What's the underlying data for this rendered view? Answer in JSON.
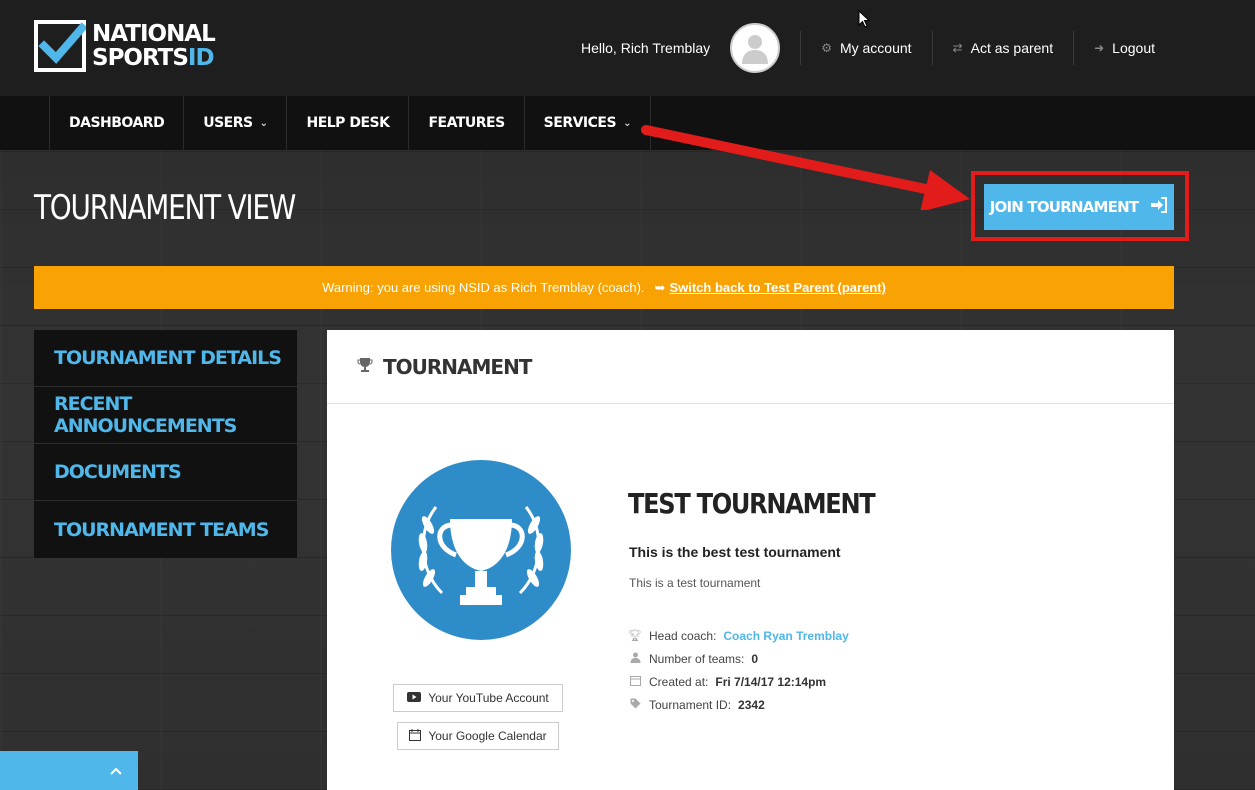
{
  "header": {
    "logo": {
      "line1": "NATIONAL",
      "line2_a": "SPORTS",
      "line2_b": "ID"
    },
    "greeting": "Hello, Rich Tremblay",
    "links": [
      {
        "label": "My account",
        "icon": "gear-icon"
      },
      {
        "label": "Act as parent",
        "icon": "swap-icon"
      },
      {
        "label": "Logout",
        "icon": "logout-icon"
      }
    ]
  },
  "nav": {
    "items": [
      {
        "label": "DASHBOARD"
      },
      {
        "label": "USERS",
        "dropdown": true
      },
      {
        "label": "HELP DESK"
      },
      {
        "label": "FEATURES"
      },
      {
        "label": "SERVICES",
        "dropdown": true
      }
    ]
  },
  "page": {
    "title": "TOURNAMENT VIEW",
    "join_button": "JOIN TOURNAMENT"
  },
  "warning": {
    "text": "Warning: you are using NSID as Rich Tremblay (coach).",
    "link": "Switch back to Test Parent (parent)"
  },
  "sidemenu": {
    "items": [
      {
        "label": "TOURNAMENT DETAILS"
      },
      {
        "label": "RECENT ANNOUNCEMENTS"
      },
      {
        "label": "DOCUMENTS"
      },
      {
        "label": "TOURNAMENT TEAMS"
      }
    ]
  },
  "panel": {
    "heading": "TOURNAMENT",
    "youtube_button": "Your YouTube Account",
    "calendar_button": "Your Google Calendar",
    "name": "TEST TOURNAMENT",
    "tagline": "This is the best test tournament",
    "description": "This is a test tournament",
    "meta": {
      "head_coach_label": "Head coach:",
      "head_coach": "Coach Ryan Tremblay",
      "teams_label": "Number of teams:",
      "teams": "0",
      "created_label": "Created at:",
      "created": "Fri 7/14/17 12:14pm",
      "id_label": "Tournament ID:",
      "id": "2342"
    }
  },
  "colors": {
    "accent": "#4fb7ea",
    "warning": "#f9a204",
    "highlight": "#e21b1b",
    "header_bg": "#1e1e1e",
    "nav_bg": "#111111"
  }
}
